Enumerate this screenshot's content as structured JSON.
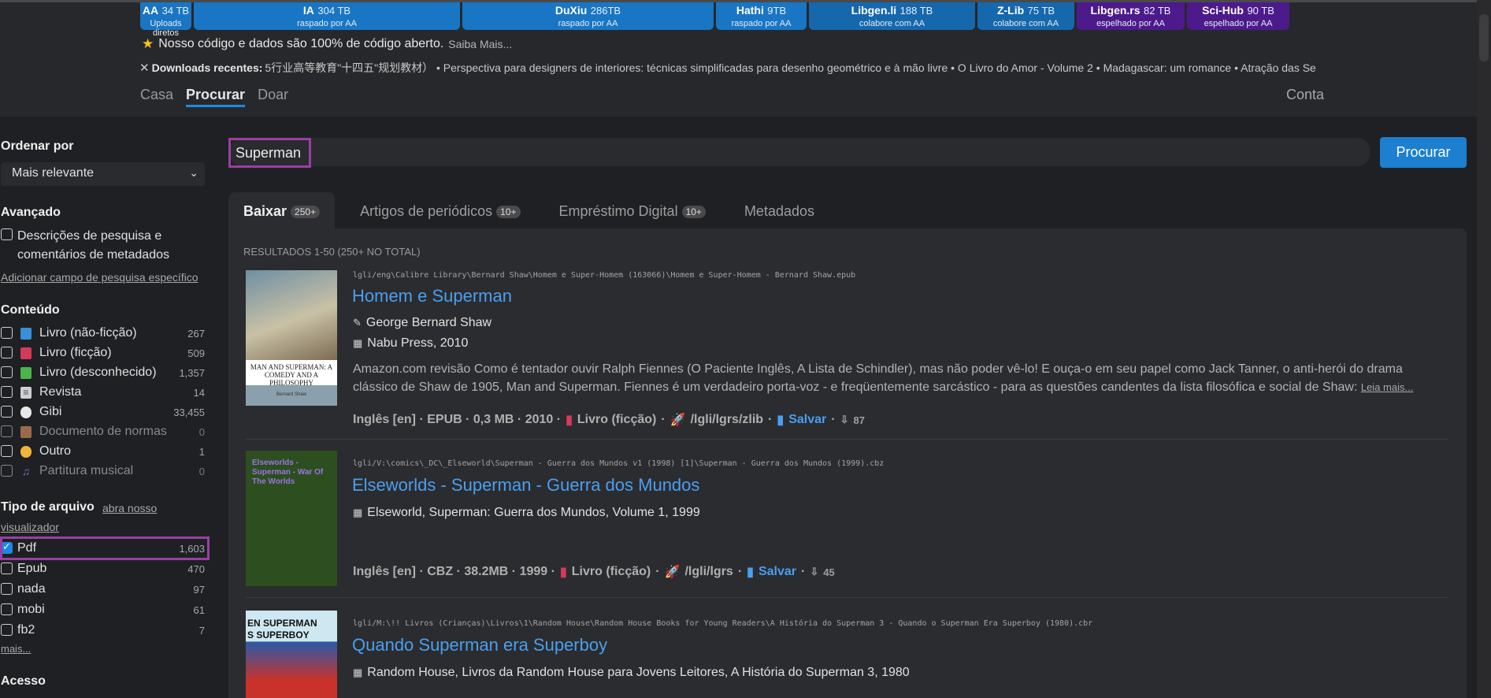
{
  "mirrors": [
    {
      "name": "AA",
      "size": "34 TB",
      "sub": "Uploads diretos"
    },
    {
      "name": "IA",
      "size": "304 TB",
      "sub": "raspado por AA"
    },
    {
      "name": "DuXiu",
      "size": "286TB",
      "sub": "raspado por AA"
    },
    {
      "name": "Hathi",
      "size": "9TB",
      "sub": "raspado por AA"
    },
    {
      "name": "Libgen.li",
      "size": "188 TB",
      "sub": "colabore com AA"
    },
    {
      "name": "Z-Lib",
      "size": "75 TB",
      "sub": "colabore com AA"
    },
    {
      "name": "Libgen.rs",
      "size": "82 TB",
      "sub": "espelhado por AA"
    },
    {
      "name": "Sci-Hub",
      "size": "90 TB",
      "sub": "espelhado por AA"
    }
  ],
  "announcement": {
    "text": "Nosso código e dados são 100% de código aberto.",
    "link": "Saiba Mais..."
  },
  "recent": {
    "label": "Downloads recentes:",
    "items": "5行业高等教育\"十四五\"规划教材） • Perspectiva para designers de interiores: técnicas simplificadas para desenho geométrico e à mão livre • O Livro do Amor - Volume 2 • Madagascar: um romance • Atração das Se"
  },
  "nav": {
    "home": "Casa",
    "search": "Procurar",
    "donate": "Doar",
    "account": "Conta"
  },
  "search": {
    "value": "Superman",
    "button": "Procurar"
  },
  "tabs": [
    {
      "label": "Baixar",
      "badge": "250+"
    },
    {
      "label": "Artigos de periódicos",
      "badge": "10+"
    },
    {
      "label": "Empréstimo Digital",
      "badge": "10+"
    },
    {
      "label": "Metadados",
      "badge": ""
    }
  ],
  "sidebar": {
    "sort_heading": "Ordenar por",
    "sort_value": "Mais relevante",
    "advanced_heading": "Avançado",
    "advanced_checkbox_line1": "Descrições de pesquisa e",
    "advanced_checkbox_line2": "comentários de metadados",
    "add_field_link": "Adicionar campo de pesquisa específico",
    "content_heading": "Conteúdo",
    "content": [
      {
        "label": "Livro (não-ficção)",
        "count": "267",
        "icon": "blue-book-icon",
        "color": "#3b8fd9"
      },
      {
        "label": "Livro (ficção)",
        "count": "509",
        "icon": "red-book-icon",
        "color": "#d63a5b"
      },
      {
        "label": "Livro (desconhecido)",
        "count": "1,357",
        "icon": "green-book-icon",
        "color": "#4bb34b"
      },
      {
        "label": "Revista",
        "count": "14",
        "icon": "newspaper-icon",
        "color": "#cfcfcf"
      },
      {
        "label": "Gibi",
        "count": "33,455",
        "icon": "speech-balloon-icon",
        "color": "#e9e9e9"
      },
      {
        "label": "Documento de normas",
        "count": "0",
        "icon": "scroll-icon",
        "color": "#9b6a4a"
      },
      {
        "label": "Outro",
        "count": "1",
        "icon": "face-icon",
        "color": "#f2b53a"
      },
      {
        "label": "Partitura musical",
        "count": "0",
        "icon": "music-notes-icon",
        "color": "#7a6bc4"
      }
    ],
    "filetype_heading": "Tipo de arquivo",
    "filetype_link1": "abra nosso",
    "filetype_link2": "visualizador",
    "filetypes": [
      {
        "label": "Pdf",
        "count": "1,603"
      },
      {
        "label": "Epub",
        "count": "470"
      },
      {
        "label": "nada",
        "count": "97"
      },
      {
        "label": "mobi",
        "count": "61"
      },
      {
        "label": "fb2",
        "count": "7"
      }
    ],
    "more_link": "mais...",
    "access_heading": "Acesso"
  },
  "results": {
    "count_text": "RESULTADOS 1-50 (250+ NO TOTAL)",
    "items": [
      {
        "path": "lgli/eng\\Calibre Library\\Bernard Shaw\\Homem e Super-Homem (163066)\\Homem e Super-Homem - Bernard Shaw.epub",
        "title": "Homem e Superman",
        "author": "George Bernard Shaw",
        "publisher": "Nabu Press, 2010",
        "desc": "Amazon.com revisão Como é tentador ouvir Ralph Fiennes (O Paciente Inglês, A Lista de Schindler), mas não poder vê-lo! E ouça-o em seu papel como Jack Tanner, o anti-herói do drama clássico de Shaw de 1905, Man and Superman. Fiennes é um verdadeiro porta-voz - e freqüentemente sarcástico - para as questões candentes da lista filosófica e social de Shaw:",
        "readmore": "Leia mais...",
        "info": "Inglês [en] · EPUB · 0,3 MB · 2010 ·",
        "genre": "Livro (ficção)",
        "source": "/lgli/lgrs/zlib",
        "save": "Salvar",
        "downloads": "87",
        "cover_text": "MAN AND SUPERMAN: A COMEDY AND A PHILOSOPHY",
        "cover_author": "Bernard Shaw"
      },
      {
        "path": "lgli/V:\\comics\\_DC\\_Elseworld\\Superman - Guerra dos Mundos v1 (1998) [1]\\Superman - Guerra dos Mundos (1999).cbz",
        "title": "Elseworlds - Superman - Guerra dos Mundos",
        "publisher": "Elseworld, Superman: Guerra dos Mundos, Volume 1, 1999",
        "info": "Inglês [en] · CBZ · 38.2MB · 1999 ·",
        "genre": "Livro (ficção)",
        "source": "/lgli/lgrs",
        "save": "Salvar",
        "downloads": "45",
        "cover_text": "Elseworlds - Superman - War Of The Worlds"
      },
      {
        "path": "lgli/M:\\!! Livros (Crianças)\\Livros\\1\\Random House\\Random House Books for Young Readers\\A História do Superman 3 - Quando o Superman Era Superboy (1980).cbr",
        "title": "Quando Superman era Superboy",
        "publisher": "Random House, Livros da Random House para Jovens Leitores, A História do Superman 3, 1980",
        "cover_text": "EN SUPERMAN\nS SUPERBOY"
      }
    ]
  },
  "colors": {
    "accent": "#1e88e5",
    "link": "#4a9ff0",
    "highlight": "#9a3fa3",
    "background": "#1f2023"
  }
}
